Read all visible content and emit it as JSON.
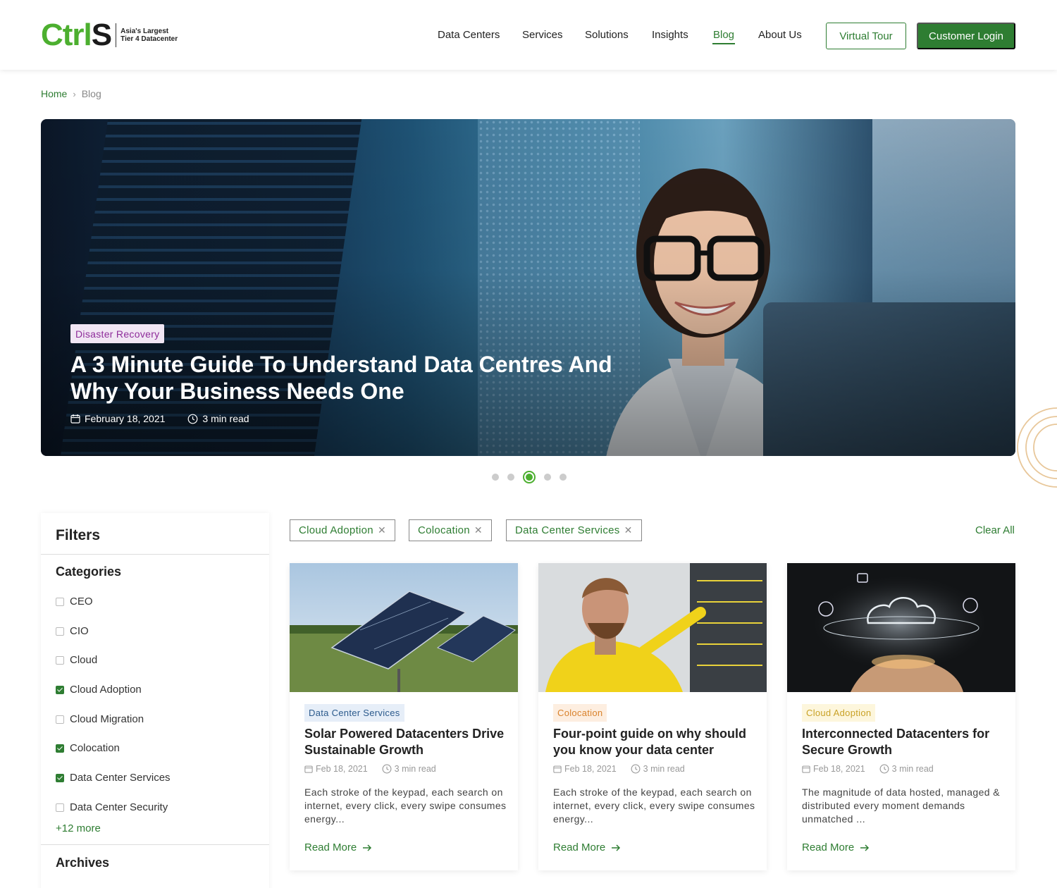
{
  "brand": {
    "logo_ctrl": "Ctrl",
    "logo_s": "S",
    "tagline_1": "Asia's Largest",
    "tagline_2": "Tier 4 Datacenter",
    "accent": "#2e7d32",
    "logo_green": "#4caf2f"
  },
  "nav": {
    "items": [
      "Data Centers",
      "Services",
      "Solutions",
      "Insights",
      "Blog",
      "About Us"
    ],
    "active": "Blog",
    "virtual_tour": "Virtual Tour",
    "customer_login": "Customer Login"
  },
  "breadcrumb": {
    "home": "Home",
    "separator": "›",
    "current": "Blog"
  },
  "hero": {
    "tag": "Disaster Recovery",
    "title_line1": "A 3 Minute Guide To Understand Data Centres And",
    "title_line2": "Why Your Business Needs One",
    "date": "February 18, 2021",
    "read_time": "3 min read",
    "slides_total": 5,
    "slide_active": 3
  },
  "filters": {
    "title": "Filters",
    "categories_title": "Categories",
    "categories": [
      {
        "label": "CEO",
        "checked": false
      },
      {
        "label": "CIO",
        "checked": false
      },
      {
        "label": "Cloud",
        "checked": false
      },
      {
        "label": "Cloud Adoption",
        "checked": true
      },
      {
        "label": "Cloud Migration",
        "checked": false
      },
      {
        "label": "Colocation",
        "checked": true
      },
      {
        "label": "Data Center Services",
        "checked": true
      },
      {
        "label": "Data Center Security",
        "checked": false
      }
    ],
    "more": "+12 more",
    "archives_title": "Archives"
  },
  "active_filters": {
    "chips": [
      "Cloud Adoption",
      "Colocation",
      "Data Center Services"
    ],
    "clear_all": "Clear All"
  },
  "cards": [
    {
      "tag": "Data Center Services",
      "tag_color": "#2b5a8c",
      "tag_bg": "#e6eef8",
      "title": "Solar Powered Datacenters Drive Sustainable Growth",
      "date": "Feb 18, 2021",
      "read_time": "3 min read",
      "desc": "Each stroke of the keypad, each search on internet, every click, every swipe consumes energy...",
      "read_more": "Read More"
    },
    {
      "tag": "Colocation",
      "tag_color": "#d9822b",
      "tag_bg": "#fdeee0",
      "title": "Four-point guide on why should you know your data center",
      "date": "Feb 18, 2021",
      "read_time": "3 min read",
      "desc": "Each stroke of the keypad, each search on internet, every click, every swipe consumes energy...",
      "read_more": "Read More"
    },
    {
      "tag": "Cloud Adoption",
      "tag_color": "#c9a227",
      "tag_bg": "#fdf6dc",
      "title": "Interconnected Datacenters for Secure Growth",
      "date": "Feb 18, 2021",
      "read_time": "3 min read",
      "desc": "The magnitude of data hosted, managed & distributed every moment demands unmatched ...",
      "read_more": "Read More"
    }
  ]
}
